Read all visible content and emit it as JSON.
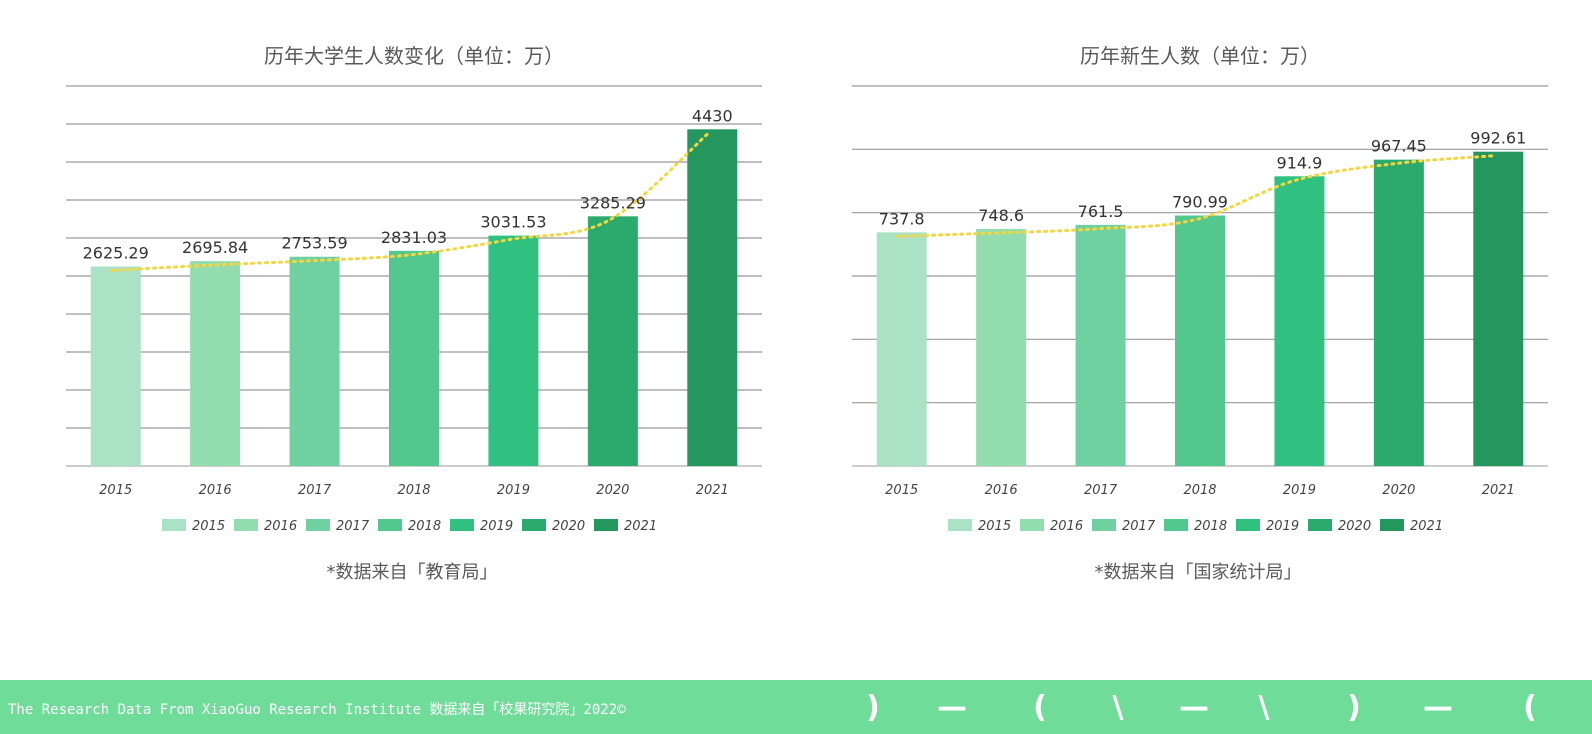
{
  "colors": {
    "bars": [
      "#a9e2c4",
      "#93dcad",
      "#6fd1a2",
      "#52c78e",
      "#30c180",
      "#2aaa6d",
      "#23975e"
    ],
    "trendline": "#f5d63c",
    "grid": "#999999",
    "footer_bg": "#70dc9a"
  },
  "chart_data": [
    {
      "type": "bar",
      "title": "历年大学生人数变化（单位：万）",
      "categories": [
        "2015",
        "2016",
        "2017",
        "2018",
        "2019",
        "2020",
        "2021"
      ],
      "values": [
        2625.29,
        2695.84,
        2753.59,
        2831.03,
        3031.53,
        3285.29,
        4430
      ],
      "value_labels": [
        "2625.29",
        "2695.84",
        "2753.59",
        "2831.03",
        "3031.53",
        "3285.29",
        "4430"
      ],
      "ylim": [
        0,
        5000
      ],
      "grid_step": 500,
      "grid": true,
      "trendline": "polynomial",
      "legend": [
        "2015",
        "2016",
        "2017",
        "2018",
        "2019",
        "2020",
        "2021"
      ],
      "legend_position": "bottom",
      "note": "*数据来自「教育局」"
    },
    {
      "type": "bar",
      "title": "历年新生人数（单位：万）",
      "categories": [
        "2015",
        "2016",
        "2017",
        "2018",
        "2019",
        "2020",
        "2021"
      ],
      "values": [
        737.8,
        748.6,
        761.5,
        790.99,
        914.9,
        967.45,
        992.61
      ],
      "value_labels": [
        "737.8",
        "748.6",
        "761.5",
        "790.99",
        "914.9",
        "967.45",
        "992.61"
      ],
      "ylim": [
        0,
        1200
      ],
      "grid_step": 200,
      "grid": true,
      "trendline": "polynomial",
      "legend": [
        "2015",
        "2016",
        "2017",
        "2018",
        "2019",
        "2020",
        "2021"
      ],
      "legend_position": "bottom",
      "note": "*数据来自「国家统计局」"
    }
  ],
  "footer": {
    "text": "The Research Data  From XiaoGuo Research Institute 数据来自「校果研究院」2022©",
    "decorations": [
      ")",
      "—",
      "(",
      "\\",
      "—",
      "\\",
      ")",
      "—",
      "("
    ]
  }
}
